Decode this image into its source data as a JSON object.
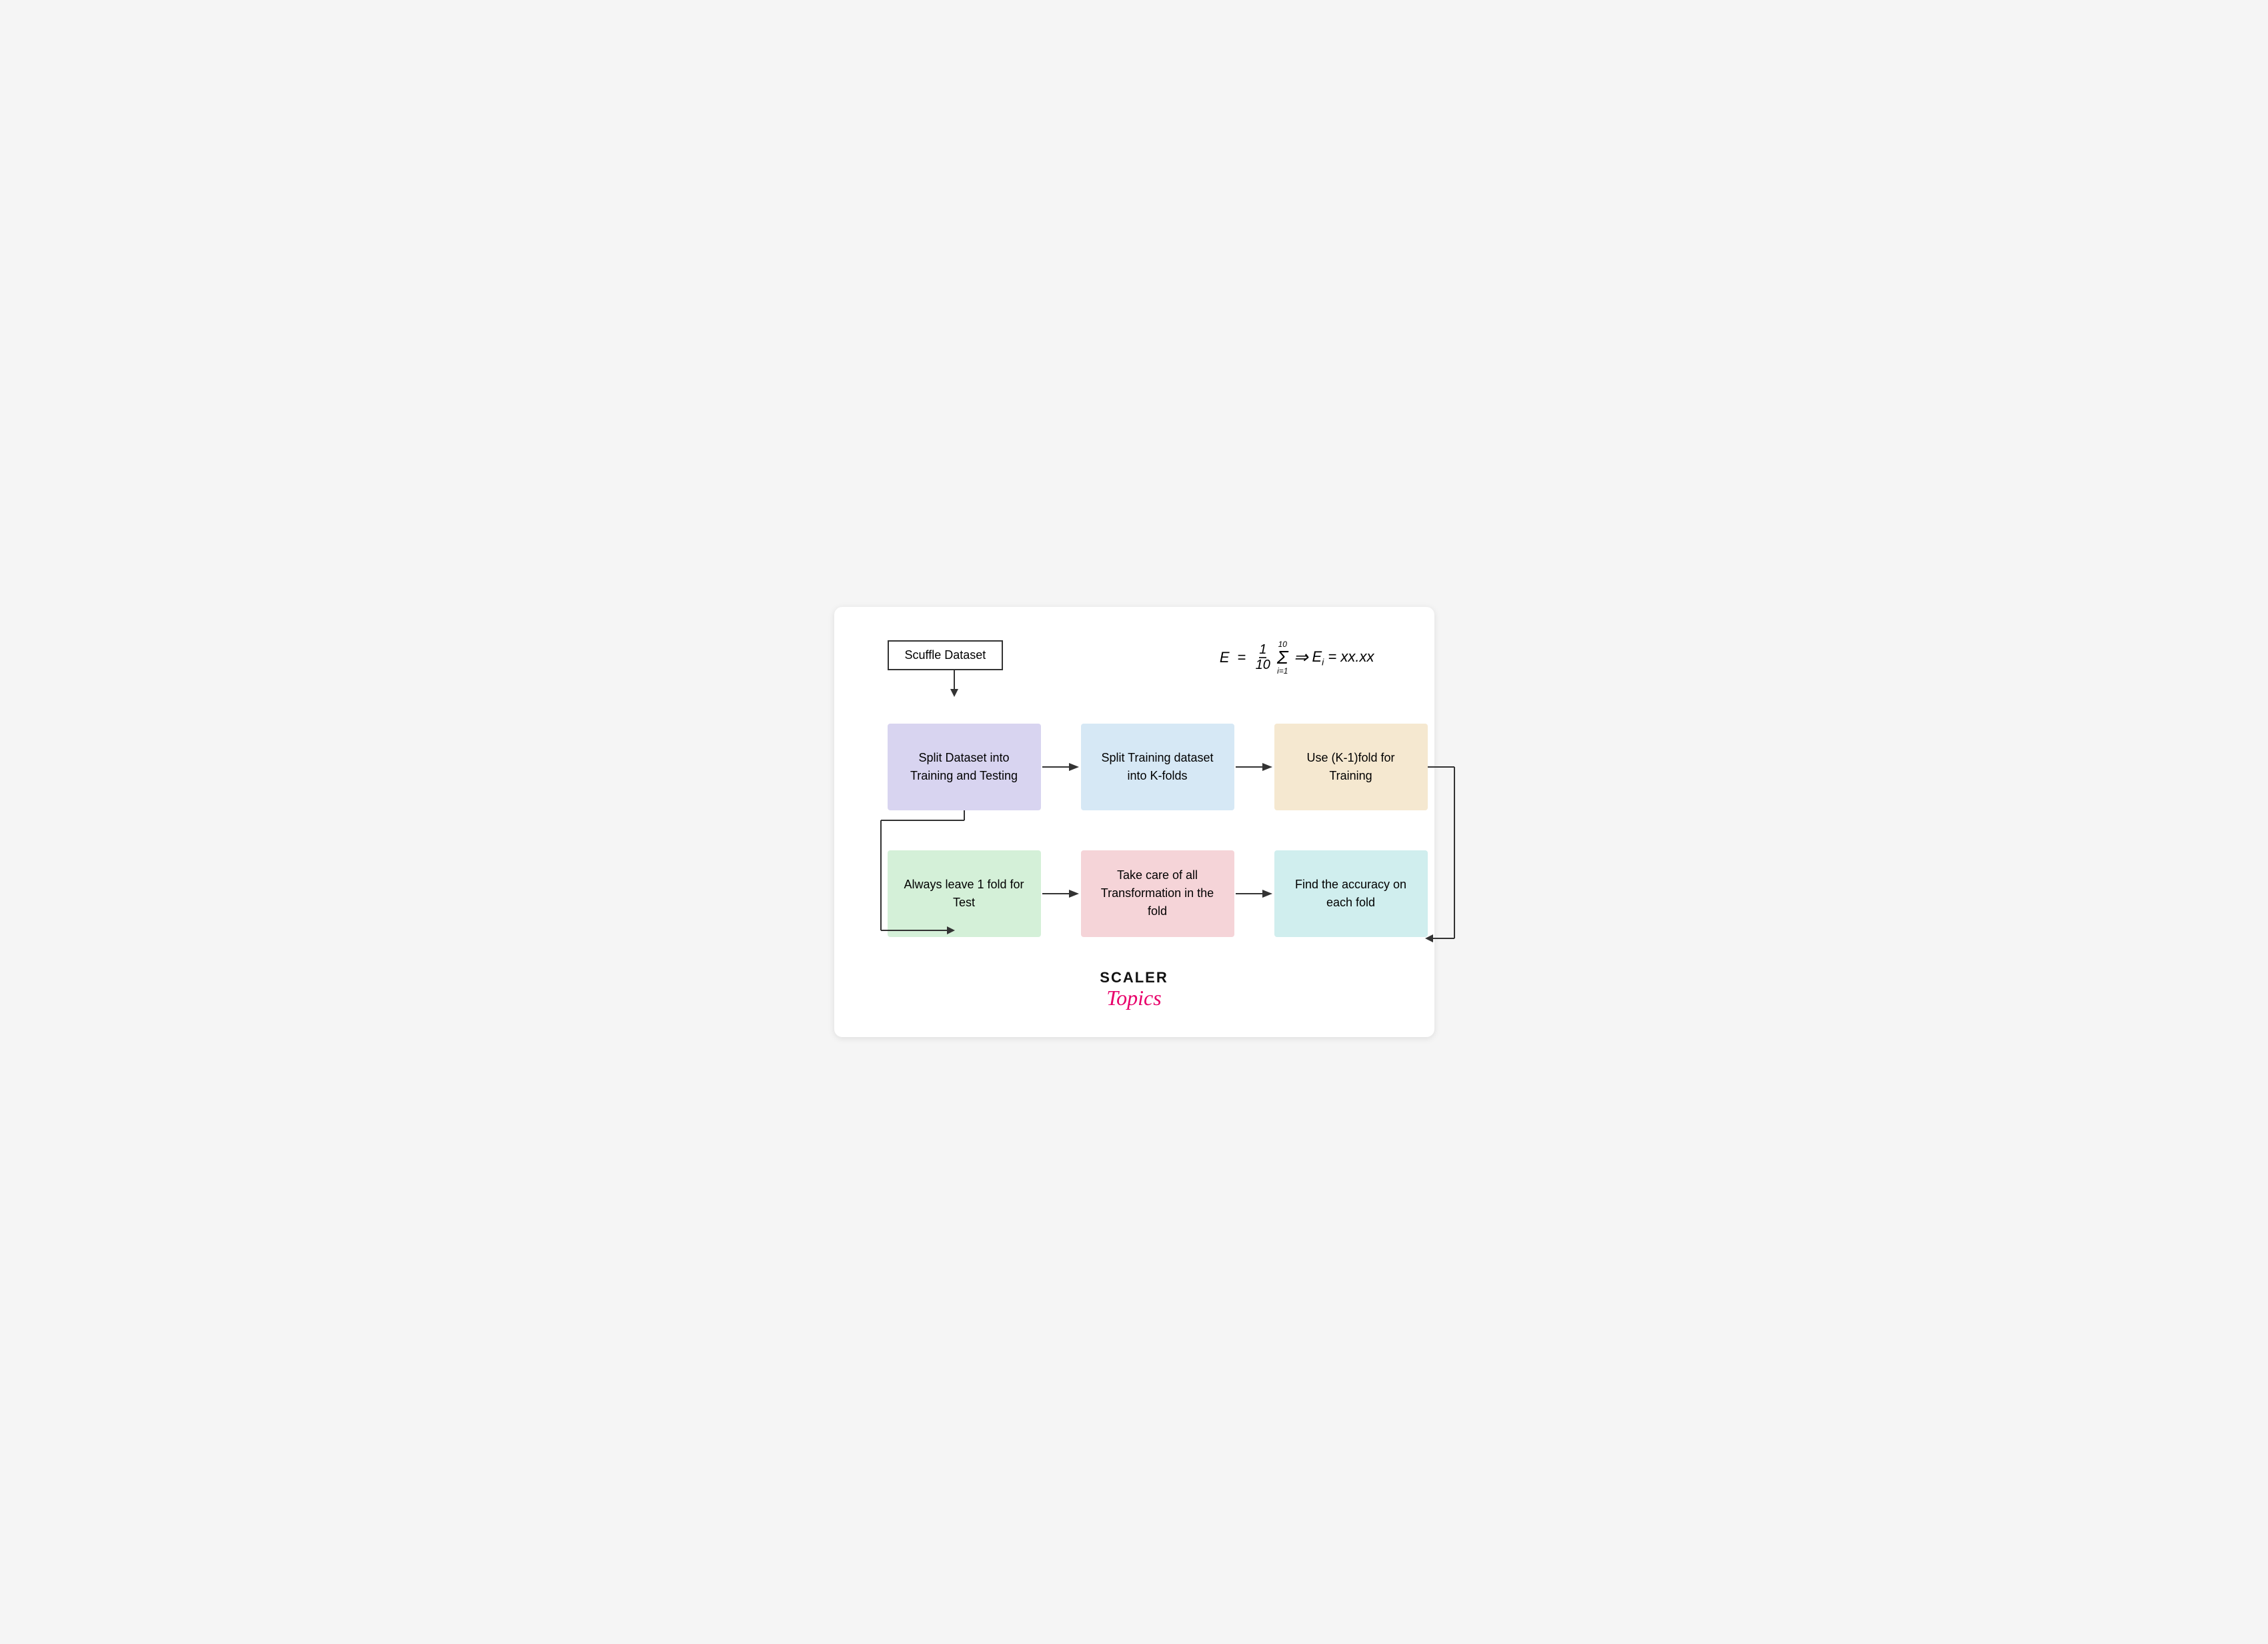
{
  "diagram": {
    "source_label": "Scuffle Dataset",
    "formula": {
      "E": "E",
      "equals": "=",
      "fraction_num": "1",
      "fraction_den": "10",
      "sigma": "Σ",
      "sigma_top": "10",
      "sigma_bot": "i=1",
      "arrow": "⇒",
      "result": "E",
      "subscript": "i",
      "value": "= xx.xx"
    },
    "row1": [
      {
        "id": "box-split-dataset",
        "label": "Split Dataset into Training and Testing",
        "color": "purple"
      },
      {
        "id": "box-split-training",
        "label": "Split Training dataset into K-folds",
        "color": "blue-light"
      },
      {
        "id": "box-use-k1",
        "label": "Use (K-1)fold for Training",
        "color": "peach"
      }
    ],
    "row2": [
      {
        "id": "box-leave-fold",
        "label": "Always leave 1 fold for Test",
        "color": "green"
      },
      {
        "id": "box-transformation",
        "label": "Take care of all Transformation in the fold",
        "color": "pink"
      },
      {
        "id": "box-accuracy",
        "label": "Find the accuracy on each fold",
        "color": "teal"
      }
    ]
  },
  "brand": {
    "scaler": "SCALER",
    "topics": "Topics"
  }
}
